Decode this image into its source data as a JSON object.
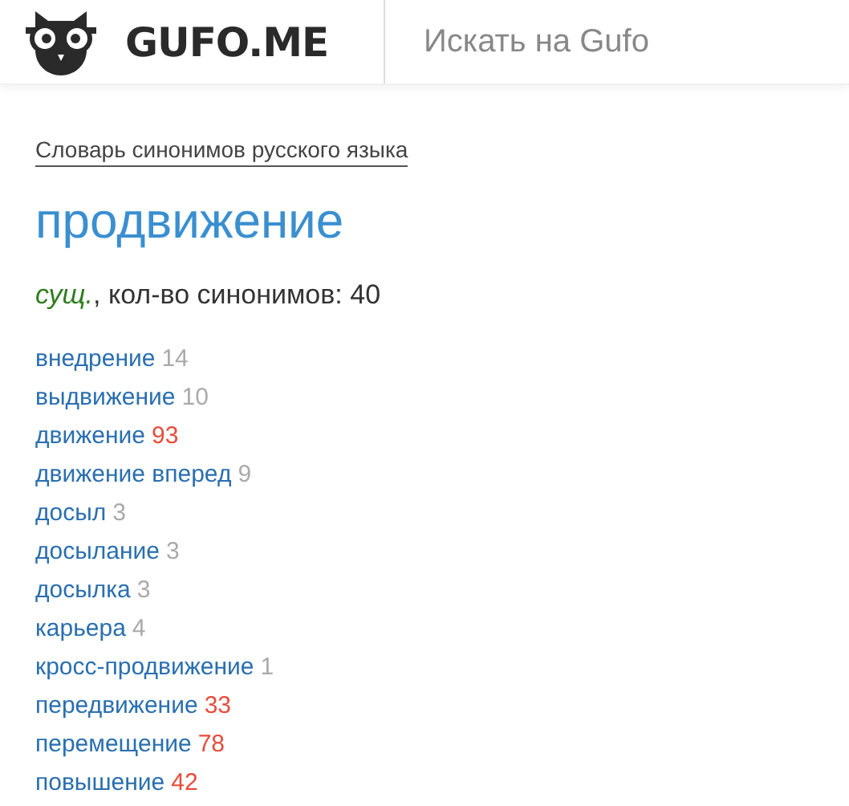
{
  "header": {
    "logo": "GUFO.ME",
    "search": {
      "placeholder": "Искать на Gufo"
    }
  },
  "breadcrumb": "Словарь синонимов русского языка",
  "word": "продвижение",
  "info": {
    "part_of_speech": "сущ.",
    "text": ", кол-во синонимов: 40"
  },
  "synonyms": [
    {
      "word": "внедрение",
      "count": "14",
      "color": "#aaaaaa"
    },
    {
      "word": "выдвижение",
      "count": "10",
      "color": "#aaaaaa"
    },
    {
      "word": "движение",
      "count": "93",
      "color": "#e74c3c"
    },
    {
      "word": "движение вперед",
      "count": "9",
      "color": "#aaaaaa"
    },
    {
      "word": "досыл",
      "count": "3",
      "color": "#aaaaaa"
    },
    {
      "word": "досылание",
      "count": "3",
      "color": "#aaaaaa"
    },
    {
      "word": "досылка",
      "count": "3",
      "color": "#aaaaaa"
    },
    {
      "word": "карьера",
      "count": "4",
      "color": "#aaaaaa"
    },
    {
      "word": "кросс-продвижение",
      "count": "1",
      "color": "#aaaaaa"
    },
    {
      "word": "передвижение",
      "count": "33",
      "color": "#e74c3c"
    },
    {
      "word": "перемещение",
      "count": "78",
      "color": "#e74c3c"
    },
    {
      "word": "повышение",
      "count": "42",
      "color": "#e74c3c"
    }
  ]
}
